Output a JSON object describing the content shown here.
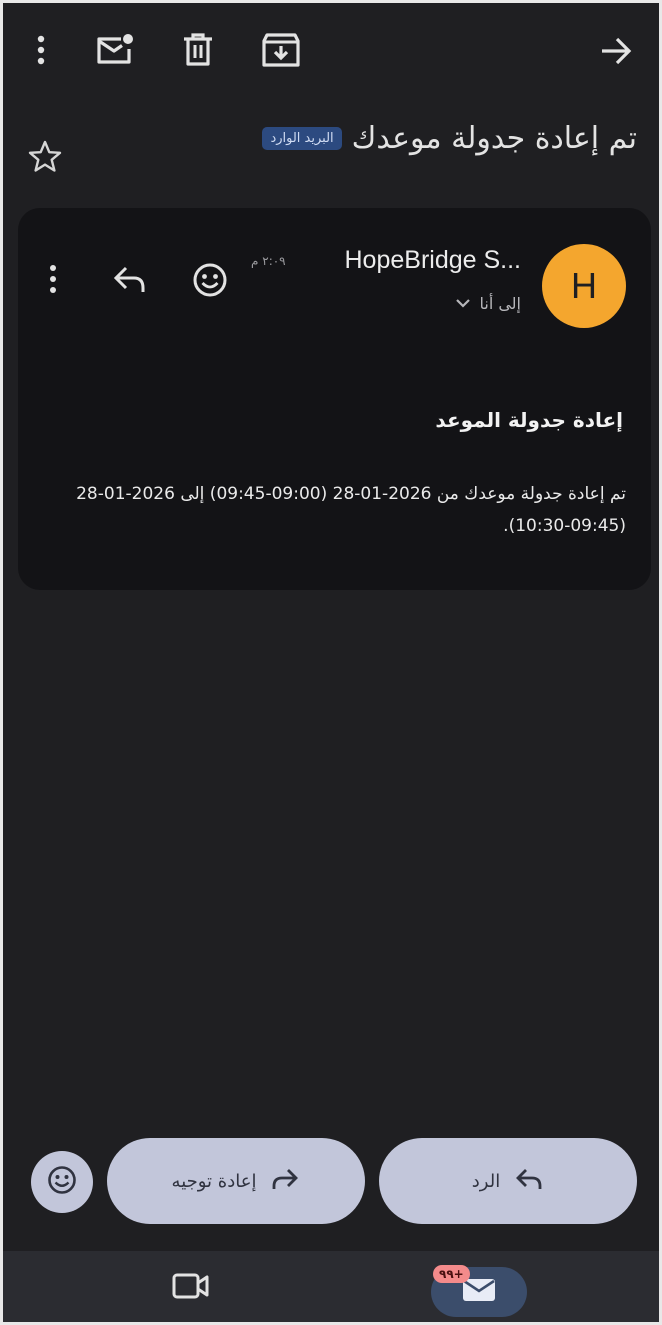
{
  "toolbar": {
    "icons": [
      "more-vert-icon",
      "mark-unread-icon",
      "delete-icon",
      "archive-icon",
      "arrow-forward-icon"
    ]
  },
  "subject": {
    "text": "تم إعادة جدولة موعدك",
    "label": "البريد الوارد"
  },
  "message": {
    "avatar_letter": "H",
    "avatar_color": "#f4a62e",
    "sender": "HopeBridge S...",
    "time": "٢:٠٩ م",
    "recipient": "إلى أنا",
    "body_title": "إعادة جدولة الموعد",
    "body_text": "تم إعادة جدولة موعدك من 2026-01-28 (09:00-09:45) إلى 2026-01-28 (09:45-10:30)."
  },
  "actions": {
    "reply_label": "الرد",
    "forward_label": "إعادة توجيه"
  },
  "bottom_nav": {
    "mail_badge": "+٩٩"
  },
  "colors": {
    "background": "#1f1f22",
    "card": "#131316",
    "pill": "#c2c6da",
    "chip": "#2c4a80",
    "badge": "#f48b8b",
    "mail_pill": "#3b4d6b"
  }
}
